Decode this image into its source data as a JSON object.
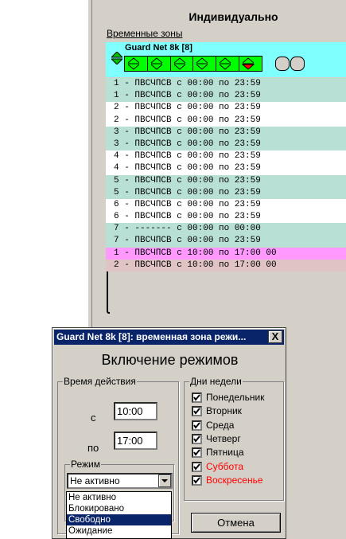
{
  "panel": {
    "title": "Индивидуально",
    "time_zones_link": "Временные зоны",
    "device_name": "Guard Net  8k [8]"
  },
  "schedule_rows": [
    {
      "text": "1 - ПВСЧПСВ с 00:00 по 23:59",
      "bg": "#b8e0d4"
    },
    {
      "text": "1 - ПВСЧПСВ с 00:00 по 23:59",
      "bg": "#b8e0d4"
    },
    {
      "text": "2 - ПВСЧПСВ с 00:00 по 23:59",
      "bg": "#ffffff"
    },
    {
      "text": "2 - ПВСЧПСВ с 00:00 по 23:59",
      "bg": "#ffffff"
    },
    {
      "text": "3 - ПВСЧПСВ с 00:00 по 23:59",
      "bg": "#b8e0d4"
    },
    {
      "text": "3 - ПВСЧПСВ с 00:00 по 23:59",
      "bg": "#b8e0d4"
    },
    {
      "text": "4 - ПВСЧПСВ с 00:00 по 23:59",
      "bg": "#ffffff"
    },
    {
      "text": "4 - ПВСЧПСВ с 00:00 по 23:59",
      "bg": "#ffffff"
    },
    {
      "text": "5 - ПВСЧПСВ с 00:00 по 23:59",
      "bg": "#b8e0d4"
    },
    {
      "text": "5 - ПВСЧПСВ с 00:00 по 23:59",
      "bg": "#b8e0d4"
    },
    {
      "text": "6 - ПВСЧПСВ с 00:00 по 23:59",
      "bg": "#ffffff"
    },
    {
      "text": "6 - ПВСЧПСВ с 00:00 по 23:59",
      "bg": "#ffffff"
    },
    {
      "text": "7 - ------- с 00:00 по 00:00",
      "bg": "#b8e0d4"
    },
    {
      "text": "7 - ПВСЧПСВ с 00:00 по 23:59",
      "bg": "#b8e0d4"
    },
    {
      "text": "1 - ПВСЧПСВ с 10:00 по 17:00 00",
      "bg": "#ff99ff"
    },
    {
      "text": "2 - ПВСЧПСВ с 10:00 по 17:00 00",
      "bg": "#e0c4c4"
    }
  ],
  "dialog": {
    "title": "Guard Net  8k [8]: временная зона режи...",
    "close": "X",
    "heading": "Включение режимов",
    "time_group": "Время действия",
    "from_label": "с",
    "from_value": "10:00",
    "to_label": "по",
    "to_value": "17:00",
    "mode_group": "Режим",
    "mode_value": "Не активно",
    "mode_options": [
      "Не активно",
      "Блокировано",
      "Свободно",
      "Ожидание"
    ],
    "mode_highlighted": "Свободно",
    "days_group": "Дни недели",
    "days": [
      {
        "label": "Понедельник",
        "checked": true,
        "color": "#000000"
      },
      {
        "label": "Вторник",
        "checked": true,
        "color": "#000000"
      },
      {
        "label": "Среда",
        "checked": true,
        "color": "#000000"
      },
      {
        "label": "Четверг",
        "checked": true,
        "color": "#000000"
      },
      {
        "label": "Пятница",
        "checked": true,
        "color": "#000000"
      },
      {
        "label": "Суббота",
        "checked": true,
        "color": "#ff0000"
      },
      {
        "label": "Воскресенье",
        "checked": true,
        "color": "#ff0000"
      }
    ],
    "cancel_label": "Отмена"
  },
  "colors": {
    "device_header": "#80ffff",
    "arrow_strip": "#00ff00",
    "title_bar": "#0a246a",
    "selected_arrow": "#ff0000"
  }
}
